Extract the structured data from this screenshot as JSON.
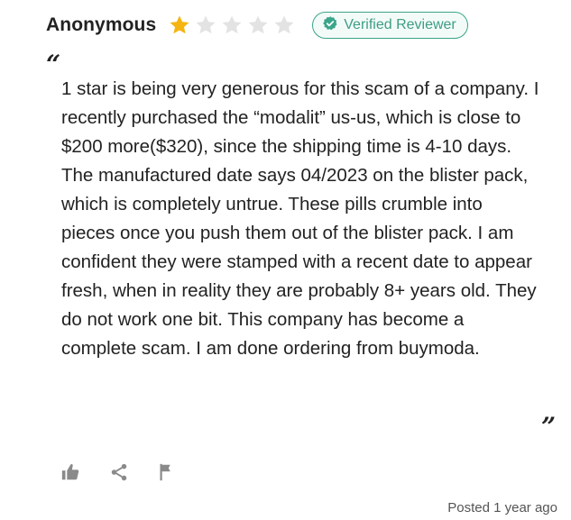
{
  "review": {
    "author": "Anonymous",
    "rating": 1,
    "max_rating": 5,
    "badge": {
      "label": "Verified Reviewer",
      "icon": "check-shield-icon",
      "color": "#3aa58a"
    },
    "open_quote": "“",
    "close_quote": "”",
    "body": "1 star is being very generous for this scam of a company. I recently purchased the “modalit” us-us, which is close to $200 more($320), since the shipping time is 4-10 days. The manufactured date says 04/2023 on the blister pack, which is completely untrue. These pills crumble into pieces once you push them out of the blister pack. I am confident they were stamped with a recent date to appear fresh, when in reality they are probably 8+ years old. They do not work one bit. This company has become a complete scam. I am done ordering from buymoda.",
    "posted": "Posted 1 year ago"
  },
  "actions": [
    {
      "icon": "thumbs-up-icon"
    },
    {
      "icon": "share-icon"
    },
    {
      "icon": "flag-icon"
    }
  ],
  "colors": {
    "star_filled": "#f5b40f",
    "star_empty": "#e3e3e3",
    "icon_gray": "#8a8a8a"
  }
}
